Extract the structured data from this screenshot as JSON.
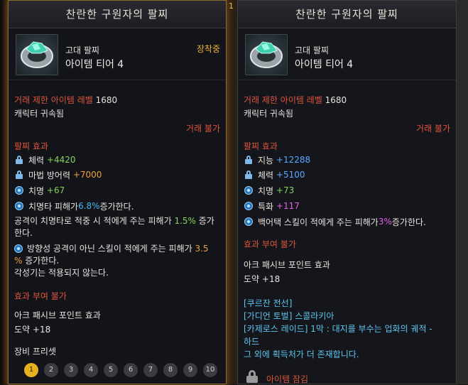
{
  "background": {
    "left_number": "1"
  },
  "left_panel": {
    "title": "찬란한 구원자의 팔찌",
    "grade": "고대 팔찌",
    "tier": "아이템 티어 4",
    "equipped": "장착중",
    "level_label": "거래 제한 아이템 레벨",
    "level_value": "1680",
    "bound": "캐릭터 귀속됨",
    "trade": "거래 불가",
    "effect_header": "팔찌 효과",
    "stats": [
      {
        "icon": "lock-icon",
        "name": "체력",
        "value": "+4420"
      },
      {
        "icon": "lock-icon",
        "name": "마법 방어력",
        "value": "+7000"
      },
      {
        "icon": "gear-icon",
        "name": "치명",
        "value": "+67"
      }
    ],
    "special1_pre": "치명타 피해가 ",
    "special1_val": "6.8%",
    "special1_post": " 증가한다.",
    "special2_pre": "공격이 치명타로 적중 시 적에게 주는 피해가 ",
    "special2_val": "1.5%",
    "special2_post": " 증가",
    "special2_wrap": "한다.",
    "special3_pre": "방향성 공격이 아닌 스킬이 적에게 주는 피해가 ",
    "special3_val": "3.5",
    "special3_val2": "%",
    "special3_post": " 증가한다.",
    "special3_note": "각성기는 적용되지 않는다.",
    "no_effect": "효과 부여 불가",
    "ark_header": "아크 패시브 포인트 효과",
    "ark_value": "도약 +18",
    "preset_header": "장비 프리셋",
    "presets": [
      "1",
      "2",
      "3",
      "4",
      "5",
      "6",
      "7",
      "8",
      "9",
      "10"
    ],
    "active_preset": "1"
  },
  "right_panel": {
    "title": "찬란한 구원자의 팔찌",
    "grade": "고대 팔찌",
    "tier": "아이템 티어 4",
    "level_label": "거래 제한 아이템 레벨",
    "level_value": "1680",
    "bound": "캐릭터 귀속됨",
    "trade": "거래 불가",
    "effect_header": "팔찌 효과",
    "stats": [
      {
        "icon": "lock-icon",
        "name": "지능",
        "value": "+12288"
      },
      {
        "icon": "lock-icon",
        "name": "체력",
        "value": "+5100"
      },
      {
        "icon": "gear-icon",
        "name": "치명",
        "value": "+73"
      },
      {
        "icon": "gear-icon",
        "name": "특화",
        "value": "+117"
      }
    ],
    "special_pre": "백어택 스킬이 적에게 주는 피해가 ",
    "special_val": "3%",
    "special_post": " 증가한다.",
    "no_effect": "효과 부여 불가",
    "ark_header": "아크 패시브 포인트 효과",
    "ark_value": "도약 +18",
    "sources": [
      "[쿠르잔 전선]",
      "[가디언 토벌] 스콜라키아",
      "[카제로스 레이드] 1막 : 대지를 부수는 업화의 궤적 -",
      "하드",
      "그 외에 획득처가 더 존재합니다."
    ],
    "locked": "아이템 잠김"
  }
}
